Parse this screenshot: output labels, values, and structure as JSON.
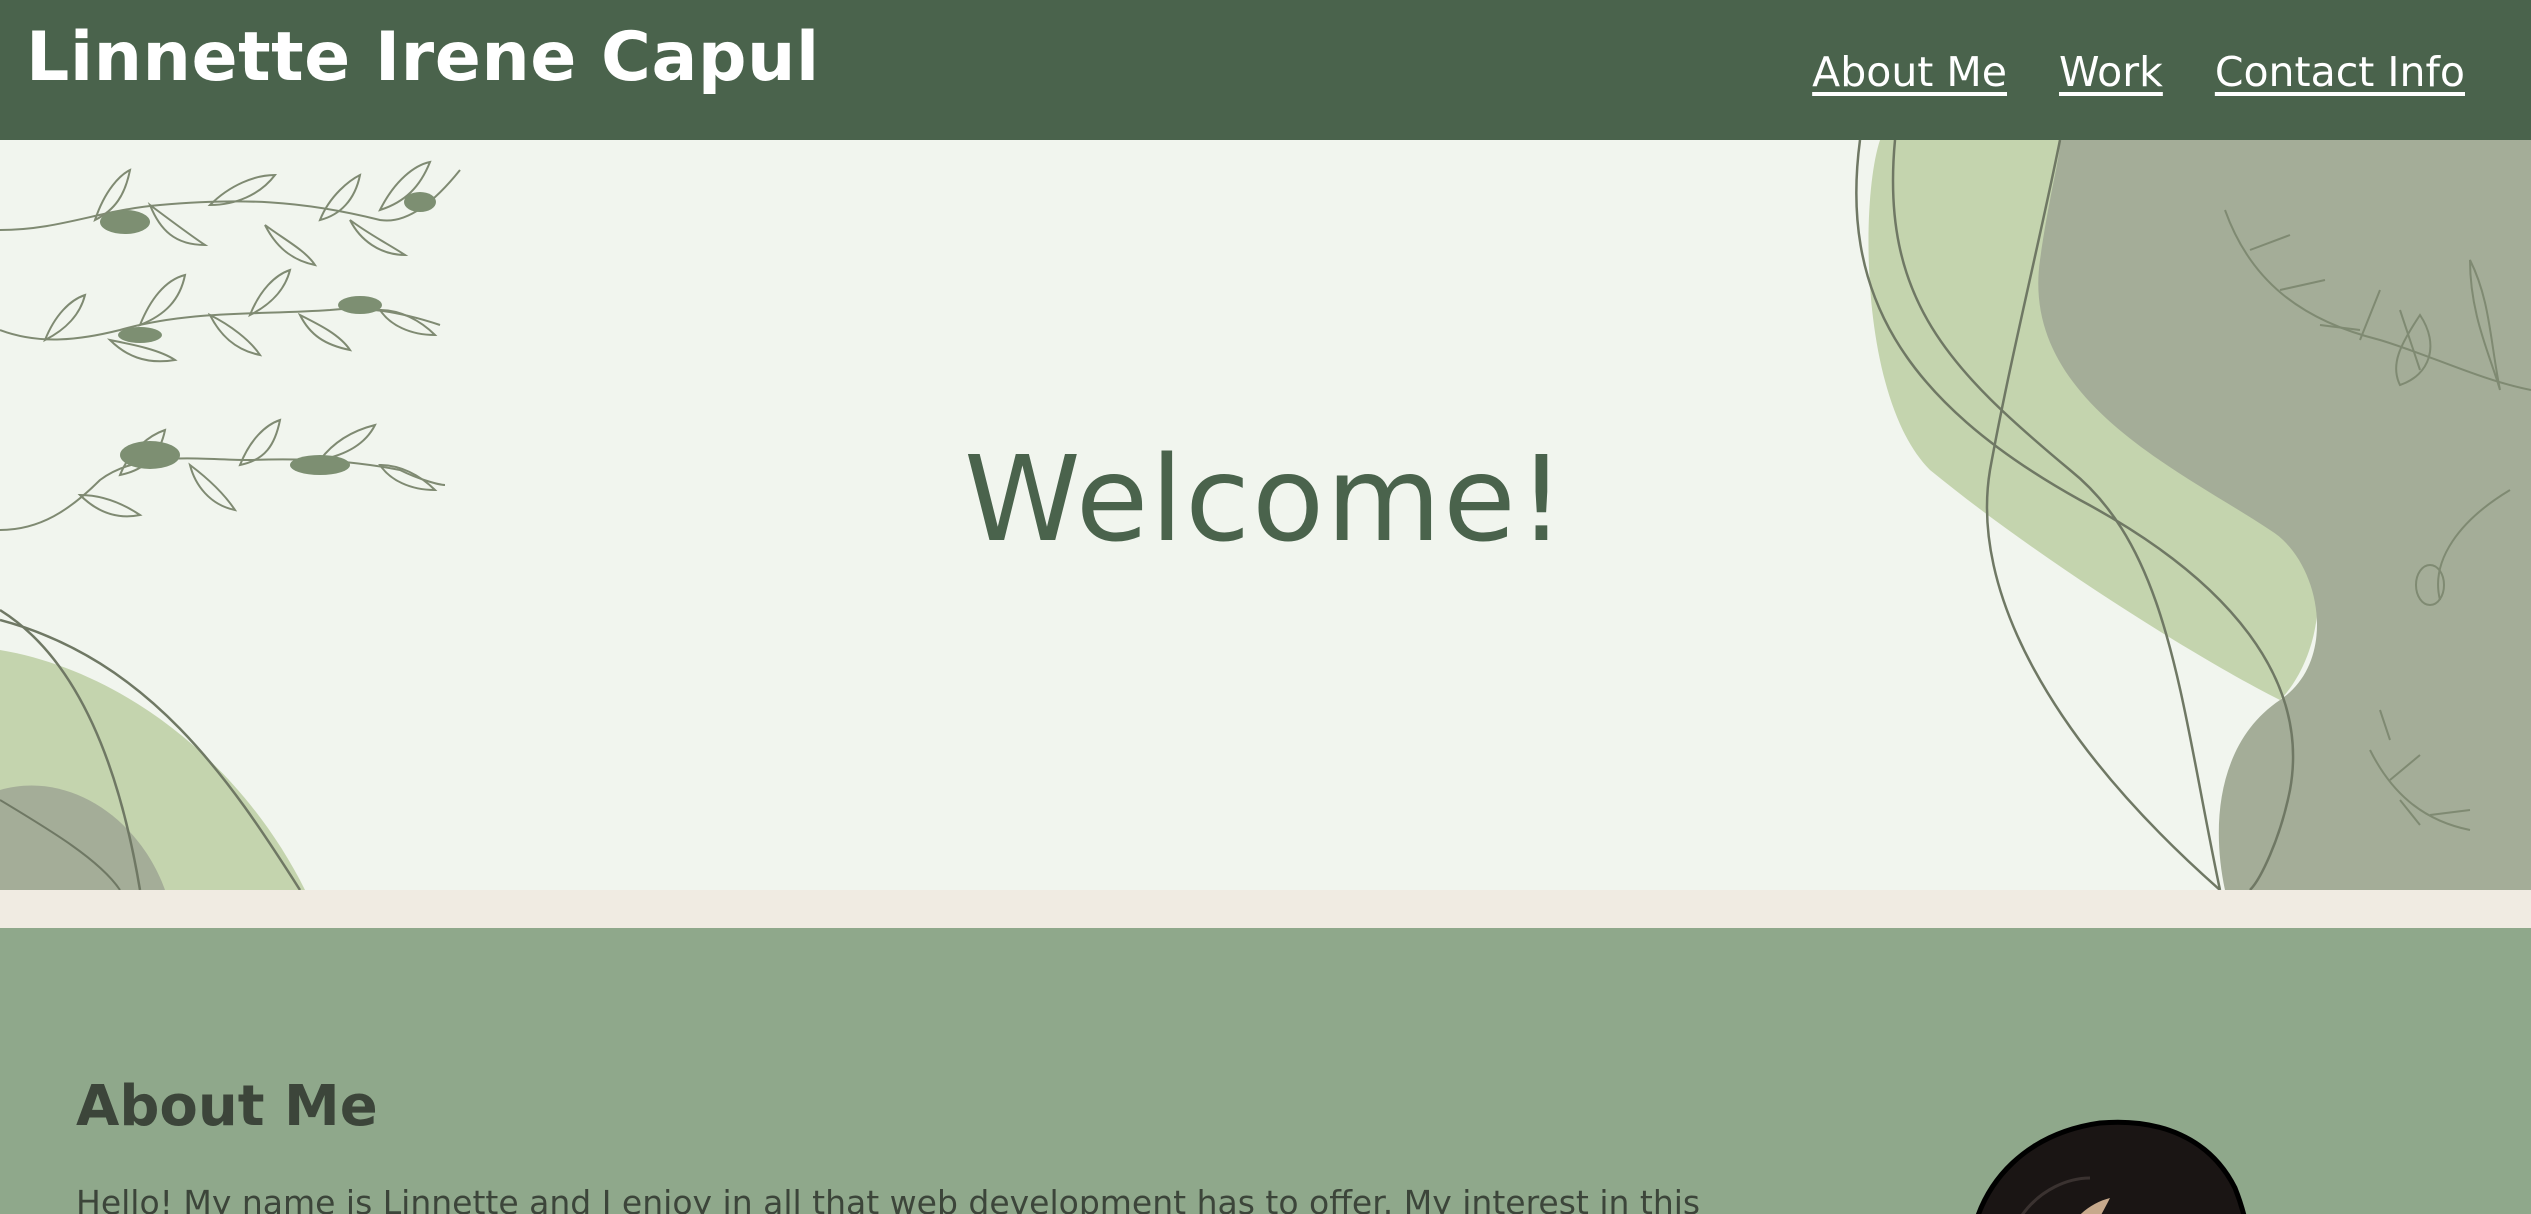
{
  "header": {
    "site_title": "Linnette Irene Capul",
    "nav": [
      {
        "label": "About Me"
      },
      {
        "label": "Work"
      },
      {
        "label": "Contact Info"
      }
    ]
  },
  "hero": {
    "title": "Welcome!"
  },
  "about": {
    "heading": "About Me",
    "text": "Hello! My name is Linnette and I enjoy in all that web development has to offer. My interest in this"
  },
  "colors": {
    "header_bg": "#4a634c",
    "hero_bg": "#f1f5ee",
    "about_bg": "#8fa88b",
    "accent_light": "#c4d4ae",
    "accent_mid": "#a4ad98"
  }
}
